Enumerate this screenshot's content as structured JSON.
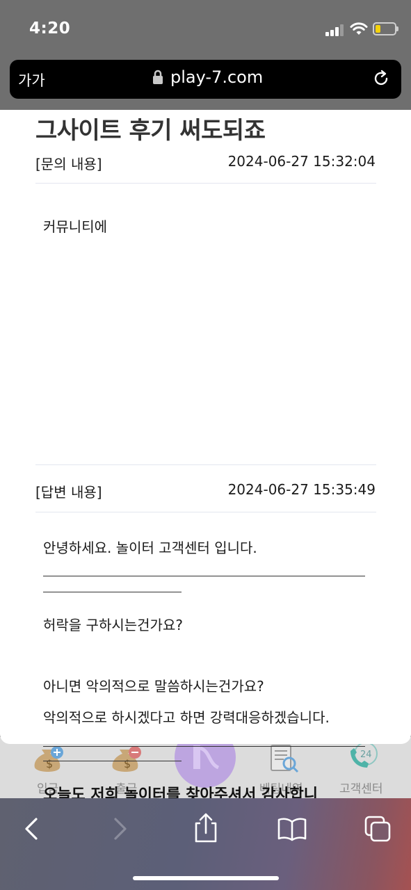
{
  "status": {
    "time": "4:20"
  },
  "browser": {
    "text_size_label": "가가",
    "url": "play-7.com"
  },
  "post": {
    "title": "그사이트 후기 써도되죠",
    "question_label": "[문의 내용]",
    "question_date": "2024-06-27 15:32:04",
    "question_body": "커뮤니티에",
    "answer_label": "[답변 내용]",
    "answer_date": "2024-06-27 15:35:49",
    "answer_lines": [
      "안녕하세요. 놀이터 고객센터 입니다.",
      "허락을 구하시는건가요?",
      "아니면 악의적으로 말씀하시는건가요?",
      "악의적으로 하시겠다고 하면 강력대응하겠습니다.",
      "오늘도 저희 놀이터를 찾아주셔서 감사합니"
    ]
  },
  "bg_nav": {
    "deposit": "입금",
    "withdraw": "출금",
    "betting": "베팅내역",
    "support": "고객센터",
    "support_badge": "24"
  },
  "colors": {
    "accent_purple": "#b79be0",
    "battery": "#f5d30a"
  }
}
